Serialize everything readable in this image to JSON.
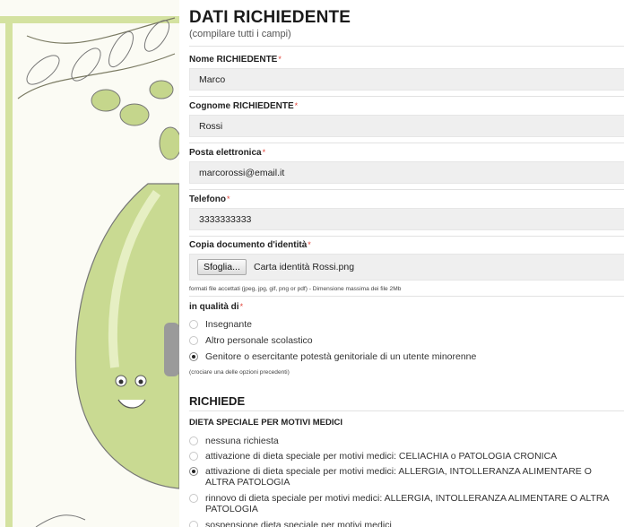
{
  "form": {
    "title": "DATI RICHIEDENTE",
    "subtitle": "(compilare tutti i campi)",
    "required_mark": "*",
    "fields": {
      "nome": {
        "label": "Nome RICHIEDENTE",
        "value": "Marco"
      },
      "cognome": {
        "label": "Cognome RICHIEDENTE",
        "value": "Rossi"
      },
      "email": {
        "label": "Posta elettronica",
        "value": "marcorossi@email.it"
      },
      "telefono": {
        "label": "Telefono",
        "value": "3333333333"
      },
      "documento": {
        "label": "Copia documento d'identità",
        "button_label": "Sfoglia...",
        "filename": "Carta identità Rossi.png",
        "hint": "formati file accettati (jpeg, jpg, gif, png or pdf) - Dimensione massima dei file 2Mb"
      }
    },
    "qualita": {
      "label": "in qualità di",
      "options": [
        {
          "label": "Insegnante",
          "checked": false
        },
        {
          "label": "Altro personale scolastico",
          "checked": false
        },
        {
          "label": "Genitore o esercitante potestà genitoriale di un utente minorenne",
          "checked": true
        }
      ],
      "hint": "(crociare una delle opzioni precedenti)"
    },
    "richiede": {
      "title": "RICHIEDE",
      "group_label": "DIETA SPECIALE PER MOTIVI MEDICI",
      "options": [
        {
          "label": "nessuna richiesta",
          "checked": false
        },
        {
          "label": "attivazione di dieta speciale per motivi medici: CELIACHIA o PATOLOGIA CRONICA",
          "checked": false
        },
        {
          "label": "attivazione di dieta speciale per motivi medici: ALLERGIA, INTOLLERANZA ALIMENTARE O ALTRA PATOLOGIA",
          "checked": true
        },
        {
          "label": "rinnovo di dieta speciale per motivi medici: ALLERGIA, INTOLLERANZA ALIMENTARE O ALTRA PATOLOGIA",
          "checked": false
        },
        {
          "label": "sospensione dieta speciale per motivi medici",
          "checked": false
        }
      ]
    }
  },
  "colors": {
    "required": "#e2453b",
    "input_bg": "#efefef",
    "illustration_green": "#c5d68c"
  }
}
